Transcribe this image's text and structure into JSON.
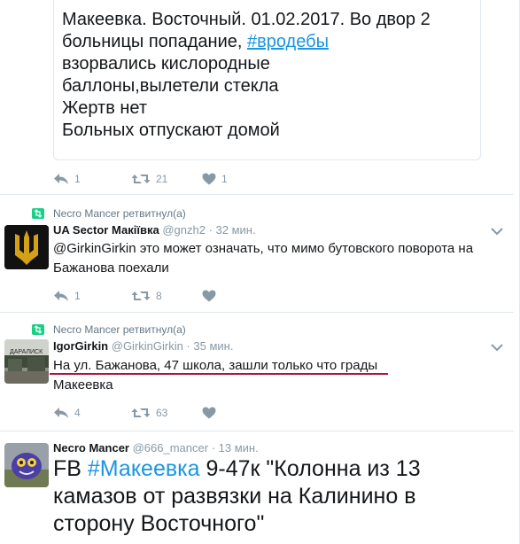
{
  "tweet1": {
    "lines": [
      "Макеевка. Восточный. 01.02.2017. Во двор 2",
      "больницы попадание, "
    ],
    "hashtag": "#вродебы",
    "rest": "взорвались кислородные\nбаллоны,вылетели стекла\nЖертв нет\nБольных отпускают домой",
    "reply_count": "1",
    "retweet_count": "21",
    "like_count": "1"
  },
  "tweet2": {
    "context": "Necro Mancer ретвитнул(а)",
    "name": "UA Sector Макіївка",
    "handle": "@gnzh2",
    "time": "· 32 мин.",
    "text": "@GirkinGirkin это может означать, что мимо бутовского поворота на Бажанова поехали",
    "reply_count": "1",
    "retweet_count": "8",
    "like_count": ""
  },
  "tweet3": {
    "context": "Necro Mancer ретвитнул(а)",
    "name": "IgorGirkin",
    "handle": "@GirkinGirkin",
    "time": "· 35 мин.",
    "text_line1": "На ул. Бажанова, 47 школа, зашли только что грады",
    "text_line2": "Макеевка",
    "avatar_caption": "ДАРАЛИСК",
    "reply_count": "4",
    "retweet_count": "63",
    "like_count": ""
  },
  "tweet4": {
    "name": "Necro Mancer",
    "handle": "@666_mancer",
    "time": "· 13 мин.",
    "text_prefix": "FB ",
    "hashtag": "#Макеевка",
    "text_rest": " 9-47к \"Колонна из 13 камазов от развязки на Калинино в сторону Восточного\""
  },
  "colors": {
    "accent": "#1b95e0",
    "muted": "#8899a6",
    "retweet_green": "#19cf86",
    "underline_red": "#b0123a"
  },
  "icons": [
    "reply-icon",
    "retweet-icon",
    "like-icon",
    "retweeted-icon",
    "chevron-down-icon"
  ]
}
